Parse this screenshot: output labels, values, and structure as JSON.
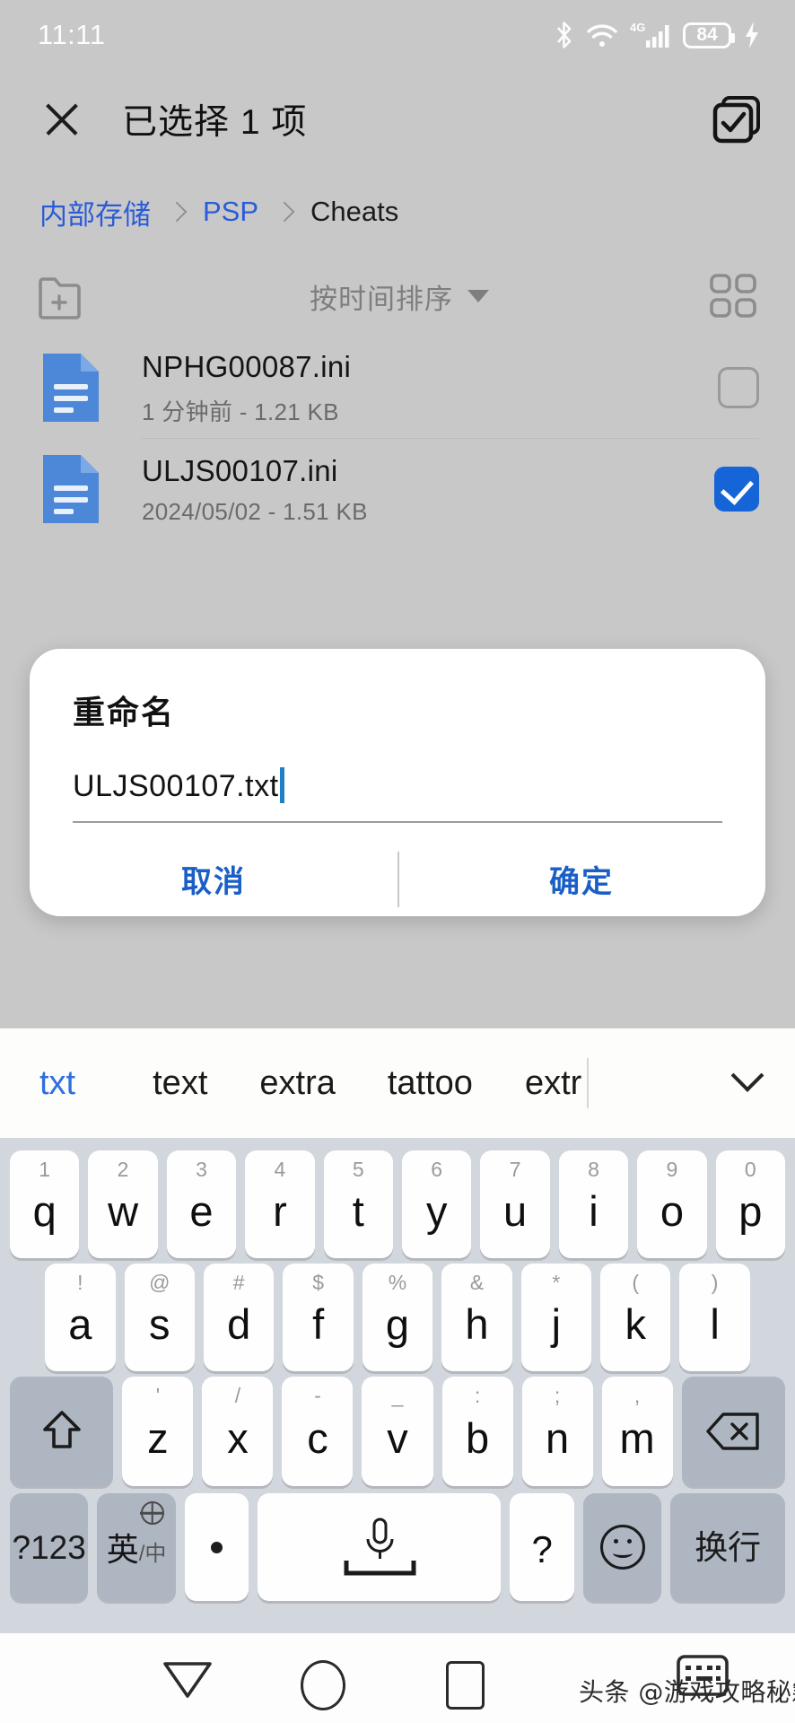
{
  "status_bar": {
    "time": "11:11",
    "battery_percent": "84",
    "network_type": "4G",
    "icons": [
      "bluetooth-icon",
      "wifi-icon",
      "signal-icon",
      "battery-icon",
      "charging-icon"
    ]
  },
  "app_bar": {
    "close_label": "close-icon",
    "title": "已选择 1 项",
    "select_all_label": "select-all-icon"
  },
  "breadcrumb": {
    "items": [
      {
        "label": "内部存储",
        "current": false
      },
      {
        "label": "PSP",
        "current": false
      },
      {
        "label": "Cheats",
        "current": true
      }
    ]
  },
  "toolbar": {
    "new_folder_label": "new-folder-icon",
    "sort_label": "按时间排序",
    "grid_view_label": "grid-view-icon"
  },
  "files": [
    {
      "name": "NPHG00087.ini",
      "meta": "1 分钟前 - 1.21 KB",
      "selected": false
    },
    {
      "name": "ULJS00107.ini",
      "meta": "2024/05/02 - 1.51 KB",
      "selected": true
    }
  ],
  "dialog": {
    "title": "重命名",
    "input_value": "ULJS00107.txt",
    "cancel_label": "取消",
    "confirm_label": "确定"
  },
  "keyboard": {
    "suggestions": [
      {
        "text": "txt",
        "active": true
      },
      {
        "text": "text",
        "active": false
      },
      {
        "text": "extra",
        "active": false
      },
      {
        "text": "tattoo",
        "active": false
      },
      {
        "text": "extr",
        "active": false
      }
    ],
    "expand_label": "chevron-down-icon",
    "row1": [
      {
        "main": "q",
        "hint": "1"
      },
      {
        "main": "w",
        "hint": "2"
      },
      {
        "main": "e",
        "hint": "3"
      },
      {
        "main": "r",
        "hint": "4"
      },
      {
        "main": "t",
        "hint": "5"
      },
      {
        "main": "y",
        "hint": "6"
      },
      {
        "main": "u",
        "hint": "7"
      },
      {
        "main": "i",
        "hint": "8"
      },
      {
        "main": "o",
        "hint": "9"
      },
      {
        "main": "p",
        "hint": "0"
      }
    ],
    "row2": [
      {
        "main": "a",
        "hint": "!"
      },
      {
        "main": "s",
        "hint": "@"
      },
      {
        "main": "d",
        "hint": "#"
      },
      {
        "main": "f",
        "hint": "$"
      },
      {
        "main": "g",
        "hint": "%"
      },
      {
        "main": "h",
        "hint": "&"
      },
      {
        "main": "j",
        "hint": "*"
      },
      {
        "main": "k",
        "hint": "("
      },
      {
        "main": "l",
        "hint": ")"
      }
    ],
    "row3": [
      {
        "main": "z",
        "hint": "'"
      },
      {
        "main": "x",
        "hint": "/"
      },
      {
        "main": "c",
        "hint": "-"
      },
      {
        "main": "v",
        "hint": "_"
      },
      {
        "main": "b",
        "hint": ":"
      },
      {
        "main": "n",
        "hint": ";"
      },
      {
        "main": "m",
        "hint": ","
      }
    ],
    "shift_label": "shift-icon",
    "backspace_label": "backspace-icon",
    "symbols_label": "?123",
    "lang_main": "英",
    "lang_sub": "/中",
    "period_label": "period-key",
    "space_label": "space-mic-key",
    "question_label": "?",
    "emoji_label": "emoji-icon",
    "enter_label": "换行"
  },
  "nav_bar": {
    "back_label": "back-icon",
    "home_label": "home-icon",
    "recents_label": "recents-icon",
    "keyboard_label": "keyboard-icon",
    "watermark": "头条 @游戏攻略秘籍"
  },
  "colors": {
    "page_bg": "#c8c8c8",
    "accent_blue": "#2a5cd7",
    "checkbox_blue": "#1565d8",
    "keyboard_bg": "#d2d7de",
    "key_bg": "#fefefe",
    "fn_key_bg": "#aeb6c2",
    "dialog_bg": "#ffffff"
  }
}
